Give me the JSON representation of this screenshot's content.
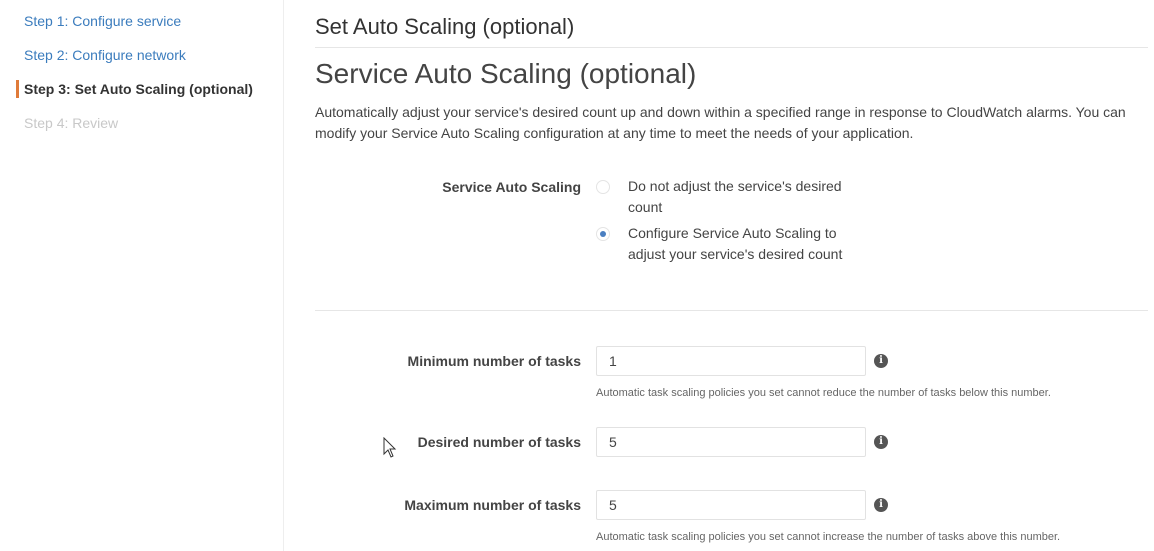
{
  "sidebar": {
    "steps": [
      {
        "label": "Step 1: Configure service",
        "state": "link"
      },
      {
        "label": "Step 2: Configure network",
        "state": "link"
      },
      {
        "label": "Step 3: Set Auto Scaling (optional)",
        "state": "active"
      },
      {
        "label": "Step 4: Review",
        "state": "disabled"
      }
    ]
  },
  "main": {
    "page_title": "Set Auto Scaling (optional)",
    "section_title": "Service Auto Scaling (optional)",
    "description": "Automatically adjust your service's desired count up and down within a specified range in response to CloudWatch alarms. You can modify your Service Auto Scaling configuration at any time to meet the needs of your application.",
    "auto_scaling": {
      "label": "Service Auto Scaling",
      "options": [
        {
          "label": "Do not adjust the service's desired count",
          "selected": false
        },
        {
          "label": "Configure Service Auto Scaling to adjust your service's desired count",
          "selected": true
        }
      ]
    },
    "min_tasks": {
      "label": "Minimum number of tasks",
      "value": "1",
      "help": "Automatic task scaling policies you set cannot reduce the number of tasks below this number."
    },
    "desired_tasks": {
      "label": "Desired number of tasks",
      "value": "5"
    },
    "max_tasks": {
      "label": "Maximum number of tasks",
      "value": "5",
      "help": "Automatic task scaling policies you set cannot increase the number of tasks above this number."
    },
    "info_icon_glyph": "i"
  },
  "colors": {
    "link": "#3b7cbd",
    "active_marker": "#e07b39",
    "radio_selected": "#4a7fc1"
  }
}
